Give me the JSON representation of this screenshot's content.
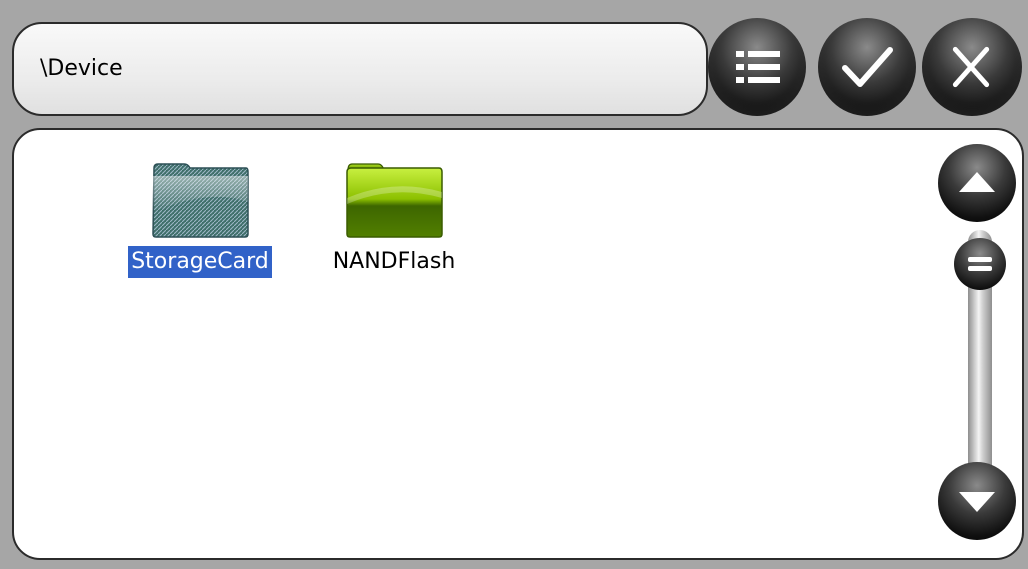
{
  "path": {
    "text": "\\Device"
  },
  "toolbar": {
    "list_icon": "list-icon",
    "ok_icon": "checkmark-icon",
    "close_icon": "close-icon"
  },
  "files": [
    {
      "label": "StorageCard",
      "icon": "folder-icon",
      "selected": true,
      "color": "#3f6f6a"
    },
    {
      "label": "NANDFlash",
      "icon": "folder-icon",
      "selected": false,
      "color": "#4a7a00"
    }
  ],
  "scrollbar": {
    "up_icon": "arrow-up-icon",
    "down_icon": "arrow-down-icon",
    "thumb_icon": "grip-icon"
  },
  "colors": {
    "selection": "#3162c8",
    "background": "#a6a6a6"
  }
}
